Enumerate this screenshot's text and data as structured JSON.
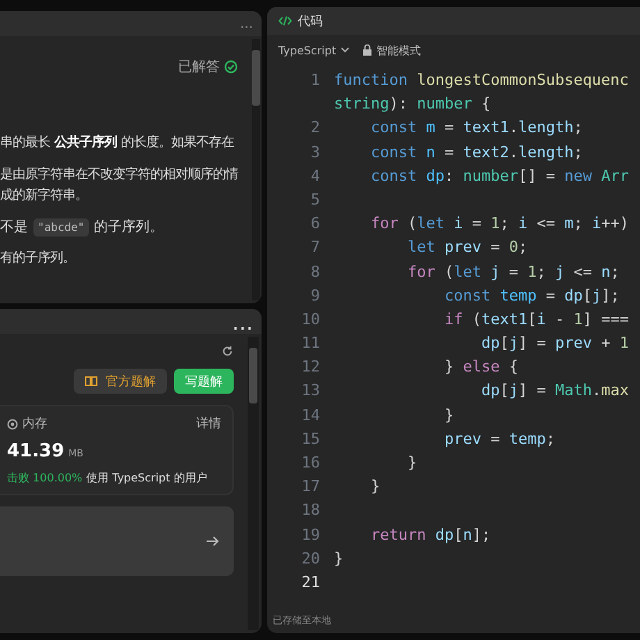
{
  "description_panel": {
    "more": "...",
    "status": "已解答",
    "paragraphs": [
      {
        "lines": [
          "串的最长 **公共子序列** 的长度。如果不存在"
        ]
      },
      {
        "lines": [
          "是由原字符串在不改变字符的相对顺序的情",
          "成的新字符串。"
        ]
      },
      {
        "parts": [
          {
            "kind": "text",
            "text": "不是"
          },
          {
            "kind": "code",
            "text": "\"abcde\""
          },
          {
            "kind": "text",
            "text": "的子序列。"
          }
        ]
      },
      {
        "lines": [
          "有的子序列。"
        ]
      }
    ]
  },
  "result_panel": {
    "more": "...",
    "official_solution_button": "官方题解",
    "write_solution_button": "写题解",
    "memory_card": {
      "label": "内存",
      "details_link": "详情",
      "value": "41.39",
      "unit": "MB",
      "beats": "击败 100.00%",
      "beats_suffix": "使用 TypeScript 的用户"
    }
  },
  "code_panel": {
    "title": "代码",
    "language": "TypeScript",
    "mode": "智能模式",
    "footer": "已存储至本地",
    "lines": [
      {
        "number": "1",
        "active": false,
        "tokens": [
          {
            "kind": "keyword",
            "text": "function"
          },
          {
            "kind": "function",
            "text": " longestCommonSubsequenc"
          }
        ]
      },
      {
        "tokens": [
          {
            "kind": "type",
            "text": "string"
          },
          {
            "kind": "plain",
            "text": "): "
          },
          {
            "kind": "type",
            "text": "number"
          },
          {
            "kind": "plain",
            "text": " {"
          }
        ]
      },
      {
        "number": "2",
        "active": false,
        "tokens": [
          {
            "kind": "keyword",
            "text": "    const"
          },
          {
            "kind": "constant",
            "text": " m"
          },
          {
            "kind": "plain",
            "text": " = "
          },
          {
            "kind": "variable",
            "text": "text1"
          },
          {
            "kind": "plain",
            "text": "."
          },
          {
            "kind": "variable",
            "text": "length"
          },
          {
            "kind": "plain",
            "text": ";"
          }
        ]
      },
      {
        "number": "3",
        "active": false,
        "tokens": [
          {
            "kind": "keyword",
            "text": "    const"
          },
          {
            "kind": "constant",
            "text": " n"
          },
          {
            "kind": "plain",
            "text": " = "
          },
          {
            "kind": "variable",
            "text": "text2"
          },
          {
            "kind": "plain",
            "text": "."
          },
          {
            "kind": "variable",
            "text": "length"
          },
          {
            "kind": "plain",
            "text": ";"
          }
        ]
      },
      {
        "number": "4",
        "active": false,
        "tokens": [
          {
            "kind": "keyword",
            "text": "    const"
          },
          {
            "kind": "constant",
            "text": " dp"
          },
          {
            "kind": "plain",
            "text": ": "
          },
          {
            "kind": "type",
            "text": "number"
          },
          {
            "kind": "plain",
            "text": "[] = "
          },
          {
            "kind": "keyword",
            "text": "new"
          },
          {
            "kind": "type",
            "text": " Arr"
          }
        ]
      },
      {
        "number": "5",
        "active": false
      },
      {
        "number": "6",
        "active": false,
        "tokens": [
          {
            "kind": "control",
            "text": "    for"
          },
          {
            "kind": "plain",
            "text": " ("
          },
          {
            "kind": "keyword",
            "text": "let"
          },
          {
            "kind": "variable",
            "text": " i"
          },
          {
            "kind": "plain",
            "text": " = "
          },
          {
            "kind": "number",
            "text": "1"
          },
          {
            "kind": "plain",
            "text": "; "
          },
          {
            "kind": "variable",
            "text": "i"
          },
          {
            "kind": "plain",
            "text": " <= "
          },
          {
            "kind": "variable",
            "text": "m"
          },
          {
            "kind": "plain",
            "text": "; "
          },
          {
            "kind": "variable",
            "text": "i"
          },
          {
            "kind": "plain",
            "text": "++)"
          }
        ]
      },
      {
        "number": "7",
        "active": false,
        "tokens": [
          {
            "kind": "keyword",
            "text": "        let"
          },
          {
            "kind": "variable",
            "text": " prev"
          },
          {
            "kind": "plain",
            "text": " = "
          },
          {
            "kind": "number",
            "text": "0"
          },
          {
            "kind": "plain",
            "text": ";"
          }
        ]
      },
      {
        "number": "8",
        "active": false,
        "tokens": [
          {
            "kind": "control",
            "text": "        for"
          },
          {
            "kind": "plain",
            "text": " ("
          },
          {
            "kind": "keyword",
            "text": "let"
          },
          {
            "kind": "variable",
            "text": " j"
          },
          {
            "kind": "plain",
            "text": " = "
          },
          {
            "kind": "number",
            "text": "1"
          },
          {
            "kind": "plain",
            "text": "; "
          },
          {
            "kind": "variable",
            "text": "j"
          },
          {
            "kind": "plain",
            "text": " <= "
          },
          {
            "kind": "variable",
            "text": "n"
          },
          {
            "kind": "plain",
            "text": ";"
          }
        ]
      },
      {
        "number": "9",
        "active": false,
        "tokens": [
          {
            "kind": "keyword",
            "text": "            const"
          },
          {
            "kind": "constant",
            "text": " temp"
          },
          {
            "kind": "plain",
            "text": " = "
          },
          {
            "kind": "variable",
            "text": "dp"
          },
          {
            "kind": "plain",
            "text": "["
          },
          {
            "kind": "variable",
            "text": "j"
          },
          {
            "kind": "plain",
            "text": "];"
          }
        ]
      },
      {
        "number": "10",
        "active": false,
        "tokens": [
          {
            "kind": "control",
            "text": "            if"
          },
          {
            "kind": "plain",
            "text": " ("
          },
          {
            "kind": "variable",
            "text": "text1"
          },
          {
            "kind": "plain",
            "text": "["
          },
          {
            "kind": "variable",
            "text": "i"
          },
          {
            "kind": "plain",
            "text": " - "
          },
          {
            "kind": "number",
            "text": "1"
          },
          {
            "kind": "plain",
            "text": "] ==="
          }
        ]
      },
      {
        "number": "11",
        "active": false,
        "tokens": [
          {
            "kind": "variable",
            "text": "                dp"
          },
          {
            "kind": "plain",
            "text": "["
          },
          {
            "kind": "variable",
            "text": "j"
          },
          {
            "kind": "plain",
            "text": "] = "
          },
          {
            "kind": "variable",
            "text": "prev"
          },
          {
            "kind": "plain",
            "text": " + "
          },
          {
            "kind": "number",
            "text": "1"
          }
        ]
      },
      {
        "number": "12",
        "active": false,
        "tokens": [
          {
            "kind": "plain",
            "text": "            } "
          },
          {
            "kind": "control",
            "text": "else"
          },
          {
            "kind": "plain",
            "text": " {"
          }
        ]
      },
      {
        "number": "13",
        "active": false,
        "tokens": [
          {
            "kind": "variable",
            "text": "                dp"
          },
          {
            "kind": "plain",
            "text": "["
          },
          {
            "kind": "variable",
            "text": "j"
          },
          {
            "kind": "plain",
            "text": "] = "
          },
          {
            "kind": "type",
            "text": "Math"
          },
          {
            "kind": "plain",
            "text": "."
          },
          {
            "kind": "function",
            "text": "max"
          }
        ]
      },
      {
        "number": "14",
        "active": false,
        "tokens": [
          {
            "kind": "plain",
            "text": "            }"
          }
        ]
      },
      {
        "number": "15",
        "active": false,
        "tokens": [
          {
            "kind": "variable",
            "text": "            prev"
          },
          {
            "kind": "plain",
            "text": " = "
          },
          {
            "kind": "variable",
            "text": "temp"
          },
          {
            "kind": "plain",
            "text": ";"
          }
        ]
      },
      {
        "number": "16",
        "active": false,
        "tokens": [
          {
            "kind": "plain",
            "text": "        }"
          }
        ]
      },
      {
        "number": "17",
        "active": false,
        "tokens": [
          {
            "kind": "plain",
            "text": "    }"
          }
        ]
      },
      {
        "number": "18",
        "active": false
      },
      {
        "number": "19",
        "active": false,
        "tokens": [
          {
            "kind": "control",
            "text": "    return"
          },
          {
            "kind": "variable",
            "text": " dp"
          },
          {
            "kind": "plain",
            "text": "["
          },
          {
            "kind": "variable",
            "text": "n"
          },
          {
            "kind": "plain",
            "text": "];"
          }
        ]
      },
      {
        "number": "20",
        "active": false,
        "tokens": [
          {
            "kind": "plain",
            "text": "}"
          }
        ]
      },
      {
        "number": "21",
        "active": true
      }
    ]
  }
}
